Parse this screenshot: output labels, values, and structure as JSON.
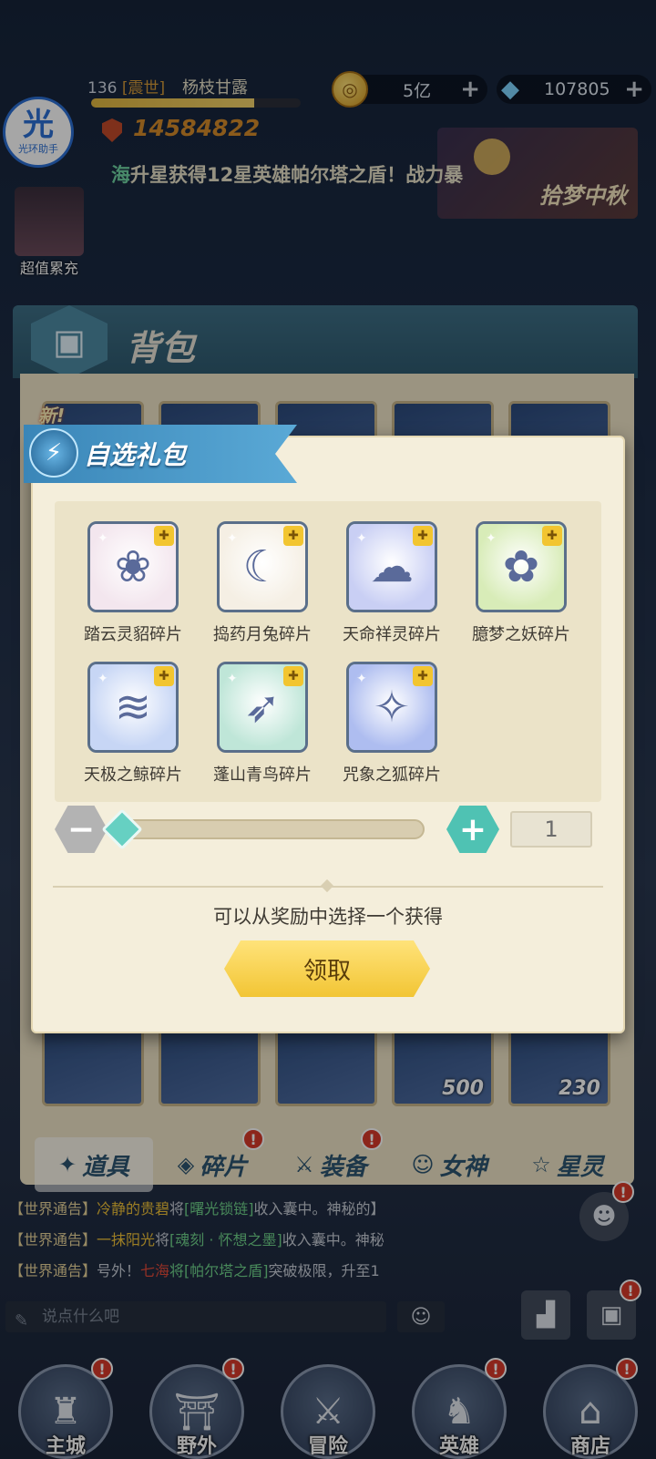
{
  "hud": {
    "level": "136",
    "guild": "[震世]",
    "player_name": "杨枝甘露",
    "exp_fraction": 0.78,
    "gold": "5亿",
    "gems": "107805",
    "power": "14584822",
    "ticker_prefix": "海",
    "ticker_text": "升星获得12星英雄帕尔塔之盾！战力暴",
    "event_title": "拾梦中秋",
    "assist_char": "光",
    "assist_label": "光环助手",
    "recharge_label": "超值累充"
  },
  "bag": {
    "title": "背包",
    "new_badge": "新!",
    "slot_counts": [
      "500",
      "230"
    ],
    "tabs": [
      {
        "label": "道具",
        "icon": "items-icon",
        "active": true,
        "alert": false
      },
      {
        "label": "碎片",
        "icon": "shards-icon",
        "active": false,
        "alert": true
      },
      {
        "label": "装备",
        "icon": "equipment-icon",
        "active": false,
        "alert": true
      },
      {
        "label": "女神",
        "icon": "goddess-icon",
        "active": false,
        "alert": false
      },
      {
        "label": "星灵",
        "icon": "star-spirit-icon",
        "active": false,
        "alert": false
      }
    ]
  },
  "chat": {
    "lines": [
      {
        "channel": "【世界通告】",
        "who": "冷静的贵碧",
        "mid": "将",
        "item": "[曙光锁链]",
        "tail": "收入囊中。神秘的】"
      },
      {
        "channel": "【世界通告】",
        "who": "一抹阳光",
        "mid": "将",
        "item": "[魂刻 · 怀想之墨]",
        "tail": "收入囊中。神秘"
      },
      {
        "channel": "【世界通告】",
        "who": "号外！",
        "mid": "七海",
        "item": "将[帕尔塔之盾]",
        "tail": "突破极限，升至1"
      }
    ],
    "placeholder": "说点什么吧"
  },
  "nav": [
    {
      "label": "主城",
      "alert": true
    },
    {
      "label": "野外",
      "alert": true
    },
    {
      "label": "冒险",
      "alert": false
    },
    {
      "label": "英雄",
      "alert": true
    },
    {
      "label": "商店",
      "alert": true
    }
  ],
  "dialog": {
    "title": "自选礼包",
    "rewards": [
      {
        "name": "踏云灵貂碎片",
        "color": "#f3e6ee"
      },
      {
        "name": "捣药月兔碎片",
        "color": "#f5efe4"
      },
      {
        "name": "天命祥灵碎片",
        "color": "#c9cff4"
      },
      {
        "name": "臆梦之妖碎片",
        "color": "#d8ecb8"
      },
      {
        "name": "天极之鲸碎片",
        "color": "#c7d6f5"
      },
      {
        "name": "蓬山青鸟碎片",
        "color": "#bfe6d8"
      },
      {
        "name": "咒象之狐碎片",
        "color": "#aebdf0"
      }
    ],
    "quantity": "1",
    "slider_fraction": 0.0,
    "hint": "可以从奖励中选择一个获得",
    "claim_label": "领取"
  }
}
